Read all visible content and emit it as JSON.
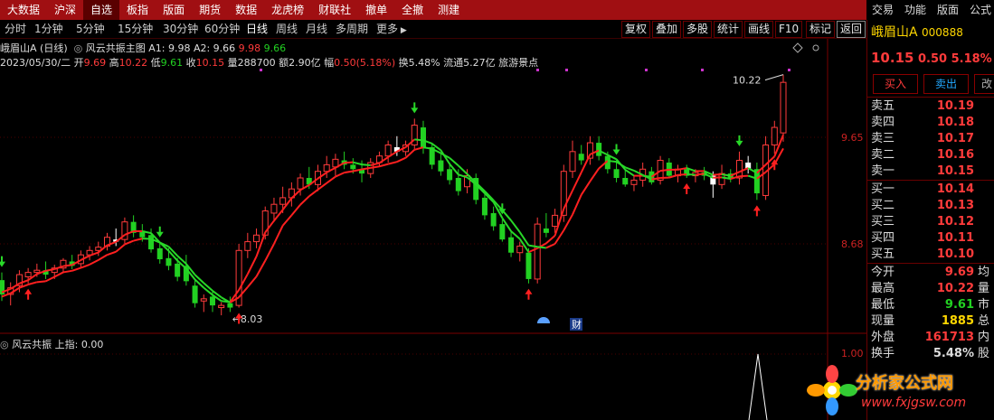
{
  "top_menu": {
    "items": [
      "大数据",
      "沪深",
      "自选",
      "板指",
      "版面",
      "期货",
      "数据",
      "龙虎榜",
      "财联社",
      "撤单",
      "全撤",
      "测建"
    ],
    "active_index": 2,
    "right_items": [
      "交易",
      "功能",
      "版面",
      "公式"
    ]
  },
  "period_tabs": [
    "分时",
    "1分钟",
    "5分钟",
    "15分钟",
    "30分钟",
    "60分钟",
    "日线",
    "周线",
    "月线",
    "多周期",
    "更多"
  ],
  "period_active": "日线",
  "toolbar_buttons": [
    "复权",
    "叠加",
    "多股",
    "统计",
    "画线",
    "F10",
    "标记",
    "返回"
  ],
  "main_info": {
    "stock_title": "峨眉山A (日线)",
    "indicator_name": "风云共振主图",
    "a1_label": "A1: 9.98",
    "a2_label": "A2: 9.66",
    "a1_val": "9.98",
    "a2_val": "9.66",
    "date": "2023/05/30/二",
    "open_label": "开",
    "open": "9.69",
    "high_label": "高",
    "high": "10.22",
    "low_label": "低",
    "low": "9.61",
    "close_label": "收",
    "close": "10.15",
    "vol_label": "量",
    "vol": "288700",
    "amount_label": "额",
    "amount": "2.90亿",
    "range_label": "幅",
    "range": "0.50(5.18%)",
    "turnover_label": "换",
    "turnover": "5.48%",
    "float_label": "流通",
    "float": "5.27亿",
    "sector": "旅游景点"
  },
  "price_axis": {
    "labels": [
      "9.65",
      "8.68"
    ],
    "high_mark": "10.22",
    "low_mark": "8.03"
  },
  "sub_info": {
    "name": "风云共振",
    "value_label": "上指:",
    "value": "0.00",
    "axis_label": "1.00"
  },
  "badges": {
    "cai": "财"
  },
  "quote": {
    "name": "峨眉山A",
    "code": "000888",
    "price": "10.15",
    "change": "0.50",
    "pct": "5.18%",
    "buy_label": "买入",
    "sell_label": "卖出",
    "asks": [
      {
        "label": "卖五",
        "price": "10.19"
      },
      {
        "label": "卖四",
        "price": "10.18"
      },
      {
        "label": "卖三",
        "price": "10.17"
      },
      {
        "label": "卖二",
        "price": "10.16"
      },
      {
        "label": "卖一",
        "price": "10.15"
      }
    ],
    "bids": [
      {
        "label": "买一",
        "price": "10.14"
      },
      {
        "label": "买二",
        "price": "10.13"
      },
      {
        "label": "买三",
        "price": "10.12"
      },
      {
        "label": "买四",
        "price": "10.11"
      },
      {
        "label": "买五",
        "price": "10.10"
      }
    ],
    "stats": [
      {
        "label": "今开",
        "value": "9.69",
        "tail": "均"
      },
      {
        "label": "最高",
        "value": "10.22",
        "tail": "量"
      },
      {
        "label": "最低",
        "value": "9.61",
        "tail": "市"
      },
      {
        "label": "现量",
        "value": "1885",
        "tail": "总"
      },
      {
        "label": "外盘",
        "value": "161713",
        "tail": "内"
      },
      {
        "label": "换手",
        "value": "5.48%",
        "tail": "股"
      }
    ]
  },
  "watermark": {
    "title": "分析家公式网",
    "url": "www.fxjgsw.com"
  },
  "colors": {
    "up": "#ff3b3b",
    "down": "#22d122",
    "flat": "#ffffff",
    "menu_bg": "#a00f12"
  },
  "chart_data": {
    "type": "candlestick",
    "y_axis": {
      "labels": [
        9.65,
        8.68
      ],
      "max_mark": 10.22,
      "min_mark": 8.03
    },
    "candles": [
      {
        "o": 8.35,
        "h": 8.42,
        "l": 8.16,
        "c": 8.22,
        "s": "down"
      },
      {
        "o": 8.22,
        "h": 8.33,
        "l": 8.12,
        "c": 8.28,
        "s": "up"
      },
      {
        "o": 8.3,
        "h": 8.44,
        "l": 8.24,
        "c": 8.4,
        "s": "up"
      },
      {
        "o": 8.38,
        "h": 8.46,
        "l": 8.32,
        "c": 8.42,
        "s": "up"
      },
      {
        "o": 8.42,
        "h": 8.5,
        "l": 8.38,
        "c": 8.44,
        "s": "up"
      },
      {
        "o": 8.44,
        "h": 8.52,
        "l": 8.36,
        "c": 8.4,
        "s": "down"
      },
      {
        "o": 8.42,
        "h": 8.49,
        "l": 8.36,
        "c": 8.46,
        "s": "up"
      },
      {
        "o": 8.46,
        "h": 8.55,
        "l": 8.42,
        "c": 8.53,
        "s": "up"
      },
      {
        "o": 8.52,
        "h": 8.58,
        "l": 8.45,
        "c": 8.48,
        "s": "down"
      },
      {
        "o": 8.5,
        "h": 8.62,
        "l": 8.46,
        "c": 8.58,
        "s": "up"
      },
      {
        "o": 8.58,
        "h": 8.66,
        "l": 8.53,
        "c": 8.62,
        "s": "up"
      },
      {
        "o": 8.62,
        "h": 8.7,
        "l": 8.57,
        "c": 8.65,
        "s": "up"
      },
      {
        "o": 8.66,
        "h": 8.78,
        "l": 8.62,
        "c": 8.74,
        "s": "up"
      },
      {
        "o": 8.72,
        "h": 8.82,
        "l": 8.66,
        "c": 8.7,
        "s": "flat"
      },
      {
        "o": 8.72,
        "h": 8.92,
        "l": 8.68,
        "c": 8.88,
        "s": "up"
      },
      {
        "o": 8.88,
        "h": 8.94,
        "l": 8.74,
        "c": 8.78,
        "s": "down"
      },
      {
        "o": 8.8,
        "h": 8.86,
        "l": 8.7,
        "c": 8.74,
        "s": "down"
      },
      {
        "o": 8.76,
        "h": 8.82,
        "l": 8.6,
        "c": 8.63,
        "s": "down"
      },
      {
        "o": 8.64,
        "h": 8.69,
        "l": 8.5,
        "c": 8.54,
        "s": "down"
      },
      {
        "o": 8.55,
        "h": 8.64,
        "l": 8.44,
        "c": 8.48,
        "s": "down"
      },
      {
        "o": 8.5,
        "h": 8.55,
        "l": 8.34,
        "c": 8.38,
        "s": "down"
      },
      {
        "o": 8.48,
        "h": 8.58,
        "l": 8.3,
        "c": 8.34,
        "s": "down"
      },
      {
        "o": 8.3,
        "h": 8.36,
        "l": 8.1,
        "c": 8.14,
        "s": "down"
      },
      {
        "o": 8.16,
        "h": 8.22,
        "l": 8.06,
        "c": 8.18,
        "s": "up"
      },
      {
        "o": 8.2,
        "h": 8.26,
        "l": 8.06,
        "c": 8.12,
        "s": "down"
      },
      {
        "o": 8.1,
        "h": 8.15,
        "l": 8.03,
        "c": 8.12,
        "s": "up"
      },
      {
        "o": 8.14,
        "h": 8.2,
        "l": 8.06,
        "c": 8.1,
        "s": "down"
      },
      {
        "o": 8.12,
        "h": 8.68,
        "l": 8.1,
        "c": 8.62,
        "s": "up"
      },
      {
        "o": 8.62,
        "h": 8.78,
        "l": 8.55,
        "c": 8.7,
        "s": "up"
      },
      {
        "o": 8.7,
        "h": 8.82,
        "l": 8.64,
        "c": 8.76,
        "s": "up"
      },
      {
        "o": 8.76,
        "h": 9.02,
        "l": 8.72,
        "c": 8.98,
        "s": "up"
      },
      {
        "o": 8.96,
        "h": 9.1,
        "l": 8.88,
        "c": 9.04,
        "s": "up"
      },
      {
        "o": 9.04,
        "h": 9.2,
        "l": 8.96,
        "c": 9.1,
        "s": "up"
      },
      {
        "o": 9.1,
        "h": 9.24,
        "l": 9.02,
        "c": 9.18,
        "s": "up"
      },
      {
        "o": 9.18,
        "h": 9.32,
        "l": 9.12,
        "c": 9.28,
        "s": "up"
      },
      {
        "o": 9.28,
        "h": 9.38,
        "l": 9.18,
        "c": 9.22,
        "s": "down"
      },
      {
        "o": 9.22,
        "h": 9.4,
        "l": 9.16,
        "c": 9.34,
        "s": "up"
      },
      {
        "o": 9.34,
        "h": 9.48,
        "l": 9.28,
        "c": 9.4,
        "s": "up"
      },
      {
        "o": 9.38,
        "h": 9.5,
        "l": 9.3,
        "c": 9.45,
        "s": "up"
      },
      {
        "o": 9.44,
        "h": 9.52,
        "l": 9.36,
        "c": 9.4,
        "s": "down"
      },
      {
        "o": 9.4,
        "h": 9.46,
        "l": 9.32,
        "c": 9.36,
        "s": "down"
      },
      {
        "o": 9.36,
        "h": 9.44,
        "l": 9.24,
        "c": 9.32,
        "s": "down"
      },
      {
        "o": 9.32,
        "h": 9.46,
        "l": 9.28,
        "c": 9.42,
        "s": "up"
      },
      {
        "o": 9.42,
        "h": 9.52,
        "l": 9.38,
        "c": 9.48,
        "s": "up"
      },
      {
        "o": 9.48,
        "h": 9.62,
        "l": 9.42,
        "c": 9.58,
        "s": "up"
      },
      {
        "o": 9.56,
        "h": 9.66,
        "l": 9.48,
        "c": 9.52,
        "s": "flat"
      },
      {
        "o": 9.52,
        "h": 9.62,
        "l": 9.48,
        "c": 9.58,
        "s": "up"
      },
      {
        "o": 9.58,
        "h": 9.82,
        "l": 9.54,
        "c": 9.76,
        "s": "up"
      },
      {
        "o": 9.74,
        "h": 9.8,
        "l": 9.5,
        "c": 9.55,
        "s": "down"
      },
      {
        "o": 9.56,
        "h": 9.6,
        "l": 9.36,
        "c": 9.4,
        "s": "down"
      },
      {
        "o": 9.44,
        "h": 9.5,
        "l": 9.3,
        "c": 9.34,
        "s": "down"
      },
      {
        "o": 9.36,
        "h": 9.42,
        "l": 9.22,
        "c": 9.26,
        "s": "down"
      },
      {
        "o": 9.28,
        "h": 9.36,
        "l": 9.12,
        "c": 9.16,
        "s": "down"
      },
      {
        "o": 9.2,
        "h": 9.36,
        "l": 9.14,
        "c": 9.3,
        "s": "up"
      },
      {
        "o": 9.28,
        "h": 9.32,
        "l": 9.04,
        "c": 9.08,
        "s": "down"
      },
      {
        "o": 9.1,
        "h": 9.16,
        "l": 8.9,
        "c": 8.94,
        "s": "down"
      },
      {
        "o": 8.96,
        "h": 9.02,
        "l": 8.8,
        "c": 8.84,
        "s": "down"
      },
      {
        "o": 8.86,
        "h": 8.9,
        "l": 8.7,
        "c": 8.72,
        "s": "down"
      },
      {
        "o": 8.74,
        "h": 8.8,
        "l": 8.56,
        "c": 8.6,
        "s": "down"
      },
      {
        "o": 8.6,
        "h": 8.7,
        "l": 8.52,
        "c": 8.66,
        "s": "up"
      },
      {
        "o": 8.6,
        "h": 8.64,
        "l": 8.32,
        "c": 8.36,
        "s": "down"
      },
      {
        "o": 8.36,
        "h": 8.92,
        "l": 8.32,
        "c": 8.86,
        "s": "up"
      },
      {
        "o": 8.82,
        "h": 8.96,
        "l": 8.74,
        "c": 8.78,
        "s": "down"
      },
      {
        "o": 8.84,
        "h": 9.0,
        "l": 8.78,
        "c": 8.94,
        "s": "up"
      },
      {
        "o": 8.94,
        "h": 9.4,
        "l": 8.88,
        "c": 9.34,
        "s": "up"
      },
      {
        "o": 9.34,
        "h": 9.62,
        "l": 9.28,
        "c": 9.52,
        "s": "up"
      },
      {
        "o": 9.5,
        "h": 9.58,
        "l": 9.4,
        "c": 9.44,
        "s": "down"
      },
      {
        "o": 9.46,
        "h": 9.66,
        "l": 9.4,
        "c": 9.6,
        "s": "up"
      },
      {
        "o": 9.6,
        "h": 9.66,
        "l": 9.44,
        "c": 9.48,
        "s": "down"
      },
      {
        "o": 9.48,
        "h": 9.52,
        "l": 9.32,
        "c": 9.36,
        "s": "down"
      },
      {
        "o": 9.36,
        "h": 9.44,
        "l": 9.24,
        "c": 9.28,
        "s": "down"
      },
      {
        "o": 9.28,
        "h": 9.36,
        "l": 9.2,
        "c": 9.22,
        "s": "down"
      },
      {
        "o": 9.22,
        "h": 9.3,
        "l": 9.16,
        "c": 9.26,
        "s": "up"
      },
      {
        "o": 9.26,
        "h": 9.42,
        "l": 9.2,
        "c": 9.36,
        "s": "up"
      },
      {
        "o": 9.34,
        "h": 9.38,
        "l": 9.22,
        "c": 9.24,
        "s": "down"
      },
      {
        "o": 9.26,
        "h": 9.48,
        "l": 9.22,
        "c": 9.44,
        "s": "up"
      },
      {
        "o": 9.42,
        "h": 9.46,
        "l": 9.28,
        "c": 9.3,
        "s": "down"
      },
      {
        "o": 9.3,
        "h": 9.4,
        "l": 9.24,
        "c": 9.36,
        "s": "up"
      },
      {
        "o": 9.36,
        "h": 9.4,
        "l": 9.28,
        "c": 9.3,
        "s": "down"
      },
      {
        "o": 9.3,
        "h": 9.36,
        "l": 9.24,
        "c": 9.33,
        "s": "up"
      },
      {
        "o": 9.33,
        "h": 9.38,
        "l": 9.26,
        "c": 9.3,
        "s": "down"
      },
      {
        "o": 9.3,
        "h": 9.34,
        "l": 9.1,
        "c": 9.22,
        "s": "flat"
      },
      {
        "o": 9.22,
        "h": 9.4,
        "l": 9.18,
        "c": 9.32,
        "s": "up"
      },
      {
        "o": 9.32,
        "h": 9.36,
        "l": 9.24,
        "c": 9.28,
        "s": "down"
      },
      {
        "o": 9.28,
        "h": 9.52,
        "l": 9.22,
        "c": 9.44,
        "s": "up"
      },
      {
        "o": 9.42,
        "h": 9.48,
        "l": 9.32,
        "c": 9.36,
        "s": "flat"
      },
      {
        "o": 9.36,
        "h": 9.42,
        "l": 9.08,
        "c": 9.14,
        "s": "down"
      },
      {
        "o": 9.12,
        "h": 9.66,
        "l": 9.08,
        "c": 9.58,
        "s": "up"
      },
      {
        "o": 9.58,
        "h": 9.8,
        "l": 9.5,
        "c": 9.74,
        "s": "up"
      },
      {
        "o": 9.69,
        "h": 10.22,
        "l": 9.61,
        "c": 10.15,
        "s": "up"
      }
    ]
  }
}
